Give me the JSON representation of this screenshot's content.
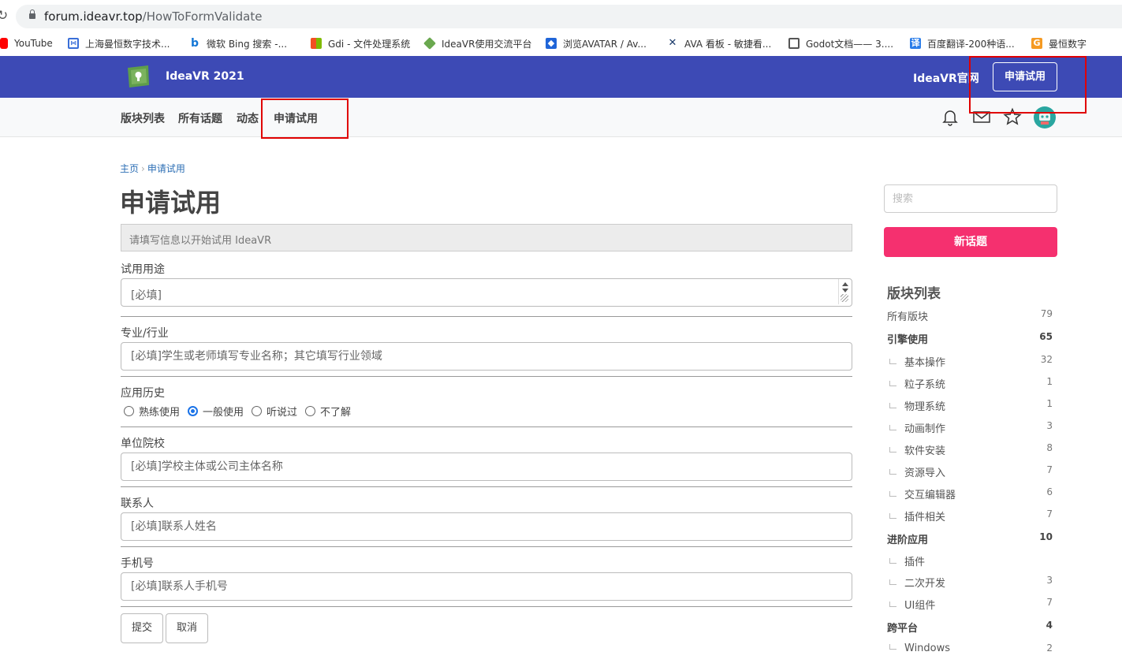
{
  "browser": {
    "url_host": "forum.ideavr.top",
    "url_path": "/HowToFormValidate",
    "bookmarks": [
      {
        "label": "YouTube",
        "icon": "youtube-icon",
        "color": "#ff0000"
      },
      {
        "label": "上海曼恒数字技术...",
        "icon": "manheng-icon",
        "color": "#3a6fd8"
      },
      {
        "label": "微软 Bing 搜索 -...",
        "icon": "bing-icon",
        "color": "#1477d6"
      },
      {
        "label": "Gdi - 文件处理系统",
        "icon": "gdi-icon",
        "color": "#f4a000"
      },
      {
        "label": "IdeaVR使用交流平台",
        "icon": "ideavr-icon",
        "color": "#6aa84f"
      },
      {
        "label": "浏览AVATAR / Av...",
        "icon": "avatar-icon",
        "color": "#2065d8"
      },
      {
        "label": "AVA 看板 - 敏捷看...",
        "icon": "ava-icon",
        "color": "#1a3a6a"
      },
      {
        "label": "Godot文档—— 3....",
        "icon": "godot-doc-icon",
        "color": "#555555"
      },
      {
        "label": "百度翻译-200种语...",
        "icon": "baidu-translate-icon",
        "color": "#2b7de9"
      },
      {
        "label": "曼恒数字",
        "icon": "manheng-digital-icon",
        "color": "#f59a23"
      }
    ]
  },
  "header": {
    "brand": "IdeaVR 2021",
    "official_link": "IdeaVR官网",
    "trial_button": "申请试用",
    "color": "#3d4ab5"
  },
  "nav": {
    "items": [
      "版块列表",
      "所有话题",
      "动态",
      "申请试用"
    ]
  },
  "page": {
    "breadcrumb_home": "主页",
    "breadcrumb_current": "申请试用",
    "title": "申请试用",
    "info": "请填写信息以开始试用 IdeaVR"
  },
  "form": {
    "purpose_label": "试用用途",
    "purpose_placeholder": "[必填]",
    "industry_label": "专业/行业",
    "industry_placeholder": "[必填]学生或老师填写专业名称；其它填写行业领域",
    "history_label": "应用历史",
    "history_options": [
      "熟练使用",
      "一般使用",
      "听说过",
      "不了解"
    ],
    "history_selected": "一般使用",
    "org_label": "单位院校",
    "org_placeholder": "[必填]学校主体或公司主体名称",
    "contact_label": "联系人",
    "contact_placeholder": "[必填]联系人姓名",
    "phone_label": "手机号",
    "phone_placeholder": "[必填]联系人手机号",
    "submit": "提交",
    "cancel": "取消"
  },
  "sidebar": {
    "search_placeholder": "搜索",
    "new_topic": "新话题",
    "new_topic_color": "#f5306f",
    "section_title": "版块列表",
    "categories": [
      {
        "name": "所有版块",
        "count": "79",
        "level": 0,
        "bold": false
      },
      {
        "name": "引擎使用",
        "count": "65",
        "level": 0,
        "bold": true
      },
      {
        "name": "基本操作",
        "count": "32",
        "level": 1,
        "bold": false
      },
      {
        "name": "粒子系统",
        "count": "1",
        "level": 1,
        "bold": false
      },
      {
        "name": "物理系统",
        "count": "1",
        "level": 1,
        "bold": false
      },
      {
        "name": "动画制作",
        "count": "3",
        "level": 1,
        "bold": false
      },
      {
        "name": "软件安装",
        "count": "8",
        "level": 1,
        "bold": false
      },
      {
        "name": "资源导入",
        "count": "7",
        "level": 1,
        "bold": false
      },
      {
        "name": "交互编辑器",
        "count": "6",
        "level": 1,
        "bold": false
      },
      {
        "name": "插件相关",
        "count": "7",
        "level": 1,
        "bold": false
      },
      {
        "name": "进阶应用",
        "count": "10",
        "level": 0,
        "bold": true
      },
      {
        "name": "插件",
        "count": "",
        "level": 1,
        "bold": false
      },
      {
        "name": "二次开发",
        "count": "3",
        "level": 1,
        "bold": false
      },
      {
        "name": "UI组件",
        "count": "7",
        "level": 1,
        "bold": false
      },
      {
        "name": "跨平台",
        "count": "4",
        "level": 0,
        "bold": true
      },
      {
        "name": "Windows",
        "count": "2",
        "level": 1,
        "bold": false
      }
    ]
  }
}
